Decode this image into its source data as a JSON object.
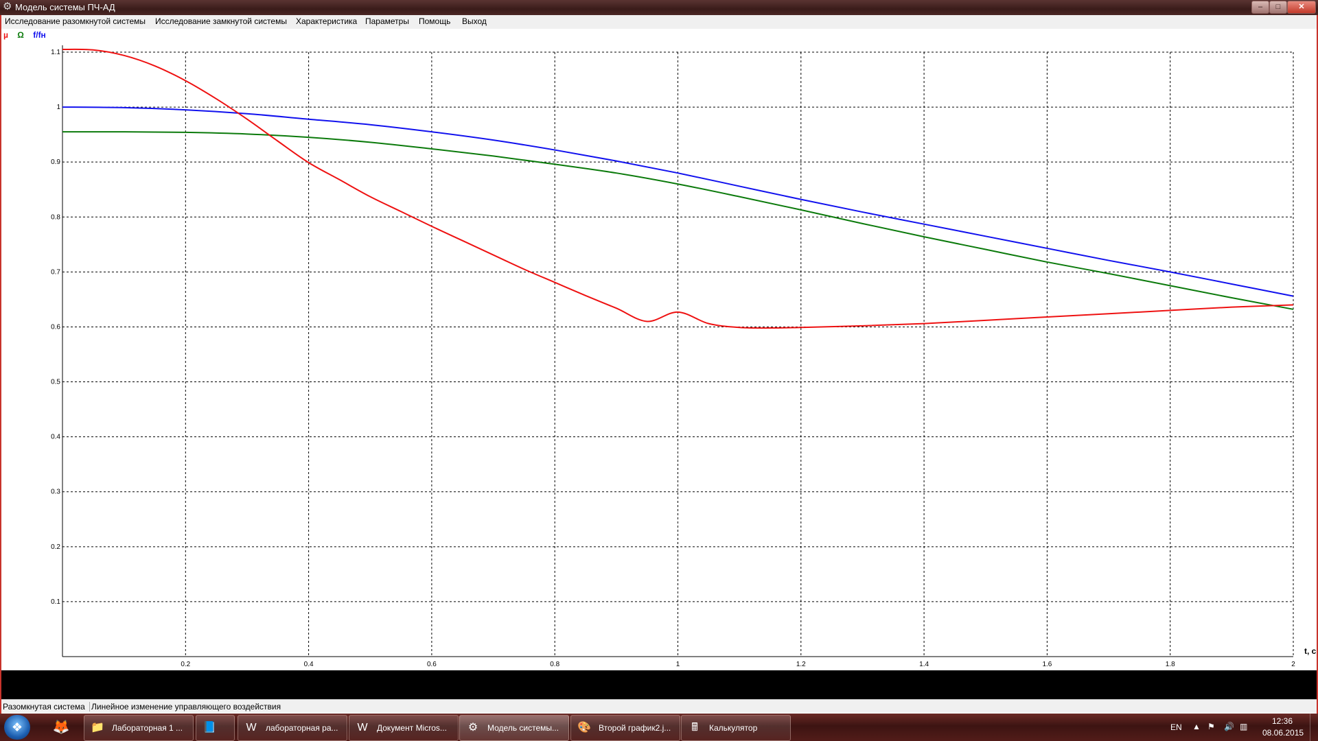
{
  "window": {
    "title": "Модель системы ПЧ-АД",
    "controls": {
      "minimize": "–",
      "maximize": "□",
      "close": "✕"
    },
    "icon": "gear-icon"
  },
  "menu": [
    "Исследование разомкнутой системы",
    "Исследование замкнутой системы",
    "Характеристика",
    "Параметры",
    "Помощь",
    "Выход"
  ],
  "legend": {
    "mu": "µ",
    "omega": "Ω",
    "f": "f/fн"
  },
  "colors": {
    "mu": "#ee1111",
    "omega": "#0b7a0b",
    "f": "#1111ee",
    "grid": "#000000"
  },
  "chart_data": {
    "type": "line",
    "xlabel": "t, c",
    "ylabel": "",
    "xlim": [
      0,
      2
    ],
    "ylim": [
      0,
      1.1
    ],
    "x_ticks": [
      "0.2",
      "0.4",
      "0.6",
      "0.8",
      "1",
      "1.2",
      "1.4",
      "1.6",
      "1.8",
      "2"
    ],
    "y_ticks": [
      "0.1",
      "0.2",
      "0.3",
      "0.4",
      "0.5",
      "0.6",
      "0.7",
      "0.8",
      "0.9",
      "1",
      "1.1"
    ],
    "grid": true,
    "series": [
      {
        "name": "µ",
        "x": [
          0,
          0.05,
          0.1,
          0.15,
          0.2,
          0.25,
          0.3,
          0.35,
          0.4,
          0.45,
          0.5,
          0.55,
          0.6,
          0.65,
          0.7,
          0.75,
          0.8,
          0.85,
          0.9,
          0.95,
          1.0,
          1.05,
          1.1,
          1.15,
          1.2,
          1.3,
          1.4,
          1.5,
          1.6,
          1.7,
          1.8,
          1.9,
          2.0
        ],
        "y": [
          1.105,
          1.104,
          1.094,
          1.075,
          1.048,
          1.015,
          0.978,
          0.938,
          0.899,
          0.868,
          0.837,
          0.81,
          0.783,
          0.757,
          0.731,
          0.705,
          0.681,
          0.657,
          0.634,
          0.61,
          0.627,
          0.606,
          0.599,
          0.598,
          0.599,
          0.602,
          0.606,
          0.612,
          0.618,
          0.624,
          0.63,
          0.636,
          0.64
        ]
      },
      {
        "name": "Ω",
        "x": [
          0,
          0.1,
          0.2,
          0.3,
          0.4,
          0.5,
          0.6,
          0.7,
          0.8,
          0.9,
          1.0,
          1.1,
          1.2,
          1.3,
          1.4,
          1.5,
          1.6,
          1.7,
          1.8,
          1.9,
          2.0
        ],
        "y": [
          0.955,
          0.955,
          0.954,
          0.951,
          0.945,
          0.936,
          0.924,
          0.911,
          0.896,
          0.88,
          0.86,
          0.837,
          0.813,
          0.788,
          0.764,
          0.741,
          0.718,
          0.697,
          0.675,
          0.653,
          0.632
        ]
      },
      {
        "name": "f/fн",
        "x": [
          0,
          0.1,
          0.2,
          0.3,
          0.4,
          0.5,
          0.6,
          0.7,
          0.8,
          0.9,
          1.0,
          1.1,
          1.2,
          1.3,
          1.4,
          1.5,
          1.6,
          1.7,
          1.8,
          1.9,
          2.0
        ],
        "y": [
          1.0,
          0.999,
          0.995,
          0.988,
          0.978,
          0.968,
          0.955,
          0.94,
          0.922,
          0.902,
          0.88,
          0.856,
          0.832,
          0.809,
          0.787,
          0.765,
          0.743,
          0.721,
          0.7,
          0.678,
          0.656
        ]
      }
    ]
  },
  "status": {
    "left": "Разомкнутая система",
    "right": "Линейное изменение управляющего воздействия"
  },
  "taskbar": {
    "start_icon": "windows-start-icon",
    "pinned": [
      "firefox-icon",
      "folder-icon"
    ],
    "tasks": [
      {
        "label": "Лабораторная 1 ...",
        "icon": "folder-icon",
        "active": false
      },
      {
        "label": "",
        "icon": "notepad-icon",
        "active": false
      },
      {
        "label": "лабораторная ра...",
        "icon": "word-icon",
        "active": false
      },
      {
        "label": "Документ Micros...",
        "icon": "word-icon",
        "active": false
      },
      {
        "label": "Модель системы...",
        "icon": "gear-icon",
        "active": true
      },
      {
        "label": "Второй график2.j...",
        "icon": "paint-icon",
        "active": false
      },
      {
        "label": "Калькулятор",
        "icon": "calculator-icon",
        "active": false
      }
    ],
    "tray": {
      "language": "EN",
      "time": "12:36",
      "date": "08.06.2015"
    }
  }
}
